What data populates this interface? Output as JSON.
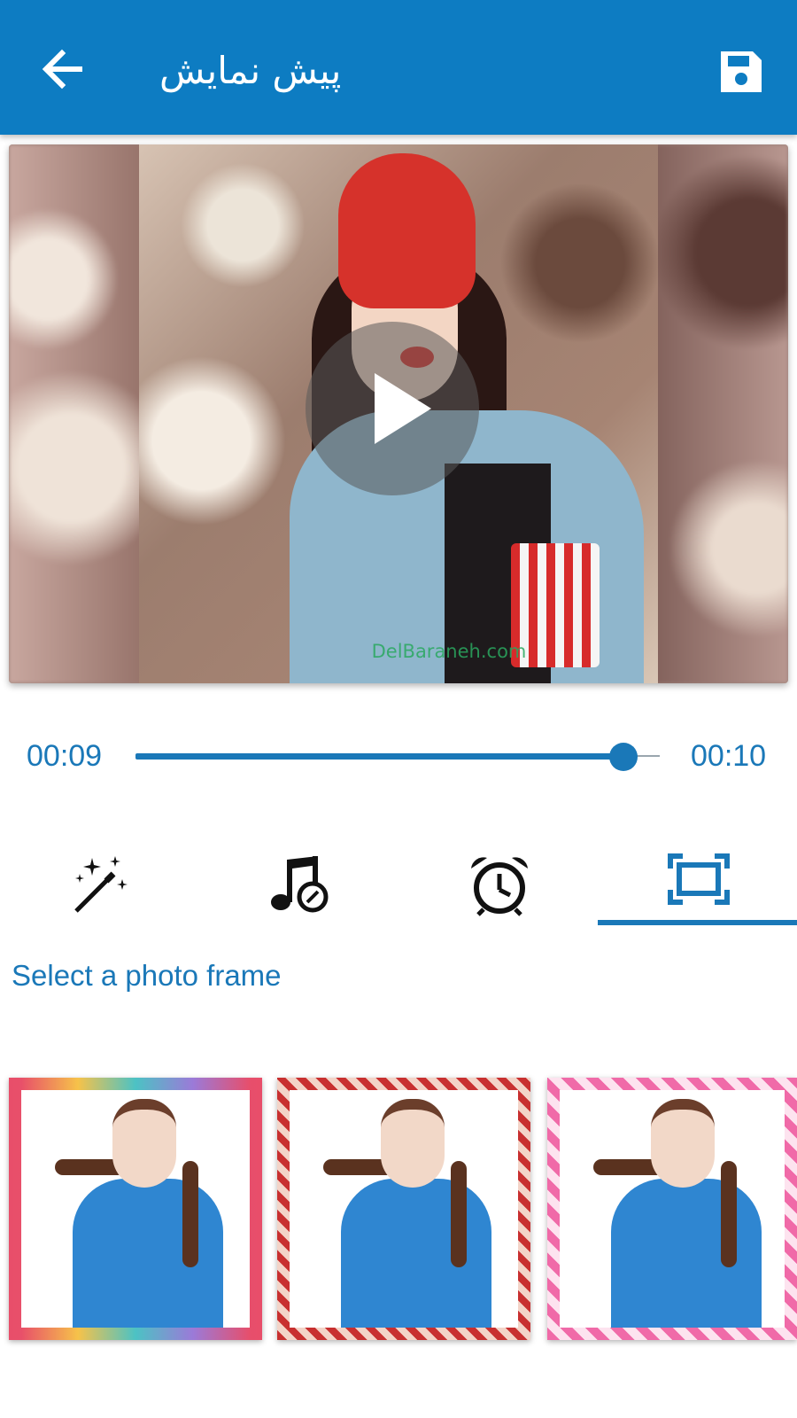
{
  "appbar": {
    "title": "پیش نمایش",
    "back_icon": "arrow-left-icon",
    "save_icon": "floppy-disk-icon",
    "color": "#0d7cc2"
  },
  "preview": {
    "watermark": "DelBaraneh.com",
    "play_icon": "play-icon"
  },
  "playback": {
    "current_time": "00:09",
    "total_time": "00:10",
    "progress": 0.93
  },
  "tabs": [
    {
      "icon": "magic-wand-icon",
      "selected": false
    },
    {
      "icon": "music-note-icon",
      "selected": false
    },
    {
      "icon": "alarm-clock-icon",
      "selected": false
    },
    {
      "icon": "frame-icon",
      "selected": true
    }
  ],
  "frames_section": {
    "label": "Select a photo frame"
  },
  "frames": [
    {
      "style": "colorful hearts border"
    },
    {
      "style": "red roses border"
    },
    {
      "style": "pink hearts border"
    }
  ],
  "accent": "#1a78b8"
}
